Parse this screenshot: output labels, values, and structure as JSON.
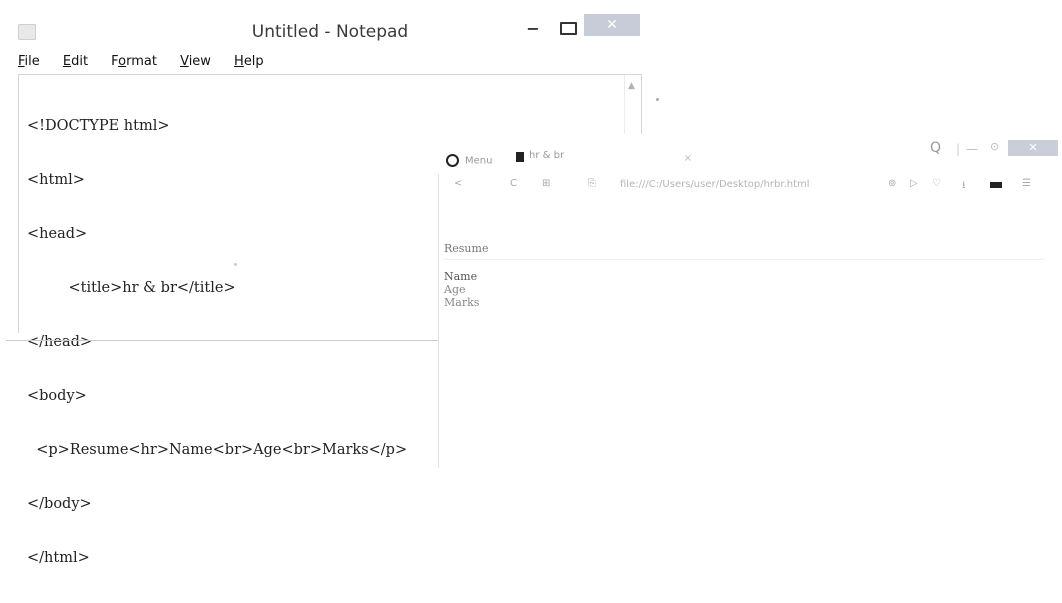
{
  "notepad": {
    "title": "Untitled - Notepad",
    "controls": {
      "minimize": "−",
      "close": "✕"
    },
    "menu": [
      {
        "first": "F",
        "rest": "ile"
      },
      {
        "first": "E",
        "rest": "dit"
      },
      {
        "first": "Fo",
        "rest": "rmat",
        "underline_index": 1
      },
      {
        "first": "V",
        "rest": "iew"
      },
      {
        "first": "H",
        "rest": "elp"
      }
    ],
    "lines": [
      "<!DOCTYPE html>",
      "<html>",
      "<head>",
      "         <title>hr & br</title>",
      "</head>",
      "<body>",
      "  <p>Resume<hr>Name<br>Age<br>Marks</p>",
      "</body>",
      "</html>"
    ]
  },
  "browser": {
    "menu_label": "Menu",
    "tab_title": "hr & br",
    "tab_close": "×",
    "nav": {
      "back": "<",
      "reload": "C",
      "grid": "⊞"
    },
    "address": "file:///C:/Users/user/Desktop/hrbr.html",
    "controls": {
      "search": "Q",
      "sep": "|",
      "minimize": "—",
      "close": "✕"
    },
    "content": {
      "heading": "Resume",
      "fields": [
        "Name",
        "Age",
        "Marks"
      ]
    }
  },
  "icons": {
    "notepad_app": "notepad-icon",
    "browser_logo": "opera-logo-icon",
    "tab_doc": "document-icon",
    "search": "search-icon"
  }
}
